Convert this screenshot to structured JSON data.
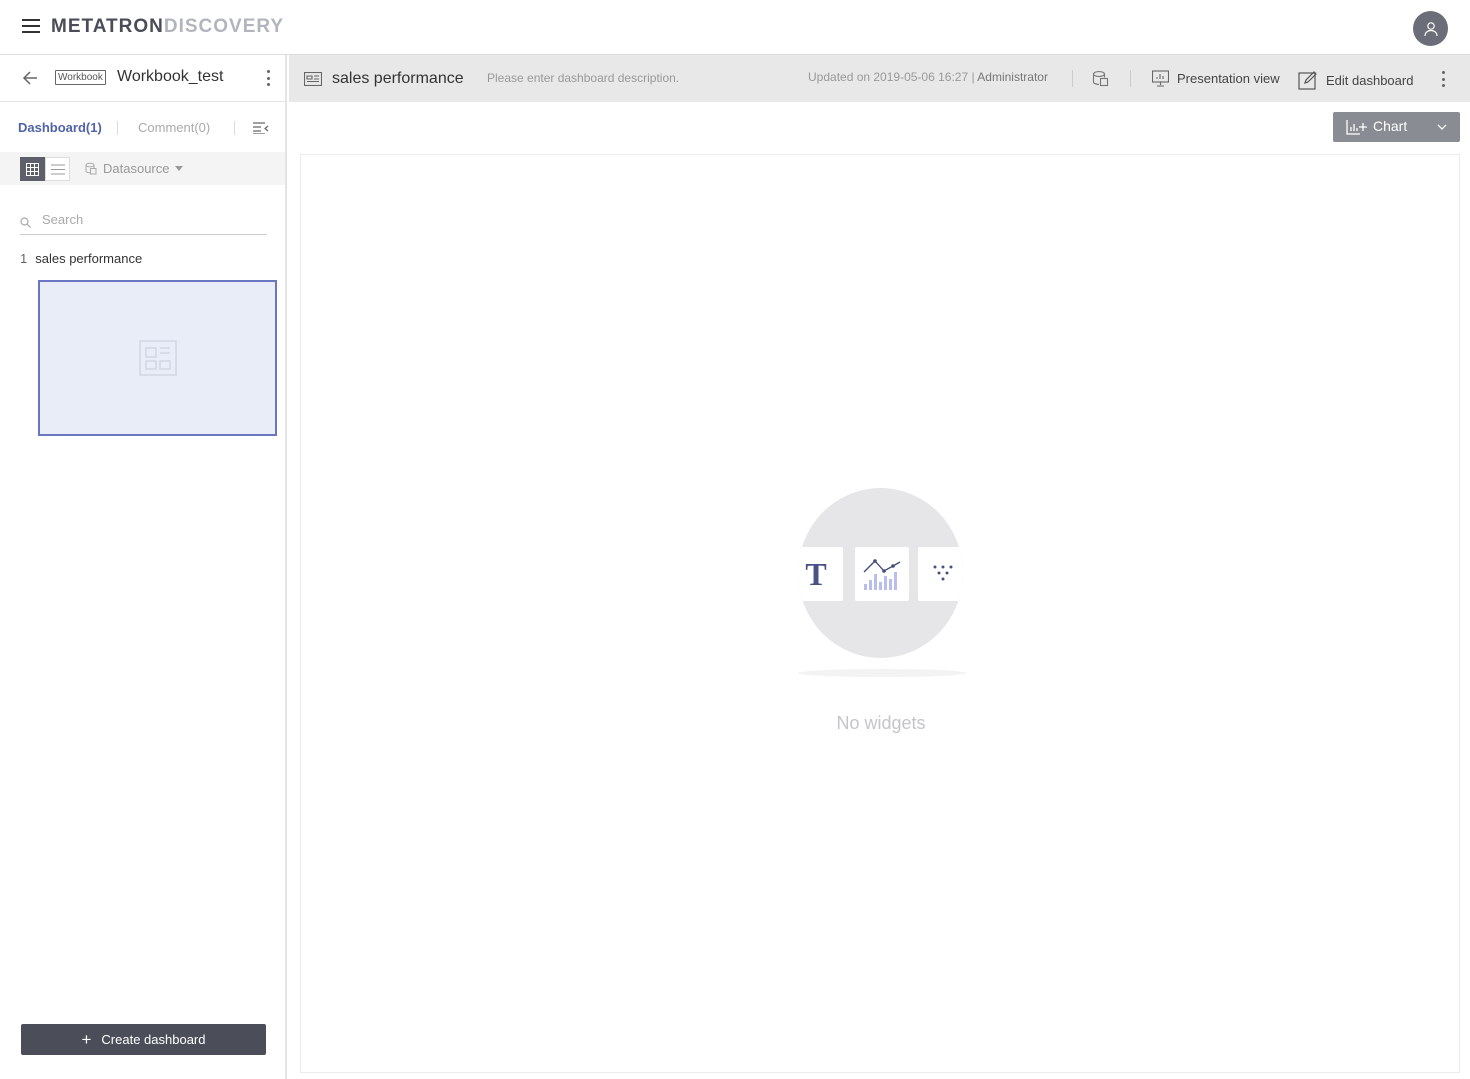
{
  "app": {
    "logo_part1": "METATRON",
    "logo_part2": "DISCOVERY"
  },
  "sidebar": {
    "workbook_badge": "Workbook",
    "workbook_name": "Workbook_test",
    "tabs": [
      {
        "label": "Dashboard(1)",
        "active": true
      },
      {
        "label": "Comment(0)",
        "active": false
      }
    ],
    "datasource_label": "Datasource",
    "search_placeholder": "Search",
    "dashboards": [
      {
        "index": "1",
        "name": "sales performance"
      }
    ],
    "create_button": "Create dashboard"
  },
  "dashboard": {
    "title": "sales performance",
    "description_placeholder": "Please enter dashboard description.",
    "updated_text": "Updated on 2019-05-06 16:27",
    "updated_by": "Administrator",
    "presentation_view": "Presentation view",
    "edit_dashboard": "Edit dashboard",
    "chart_button": "Chart",
    "empty_message": "No widgets"
  },
  "colors": {
    "accent": "#5063a8",
    "thumb_border": "#6a76c0",
    "button_dark": "#4b4e58"
  }
}
